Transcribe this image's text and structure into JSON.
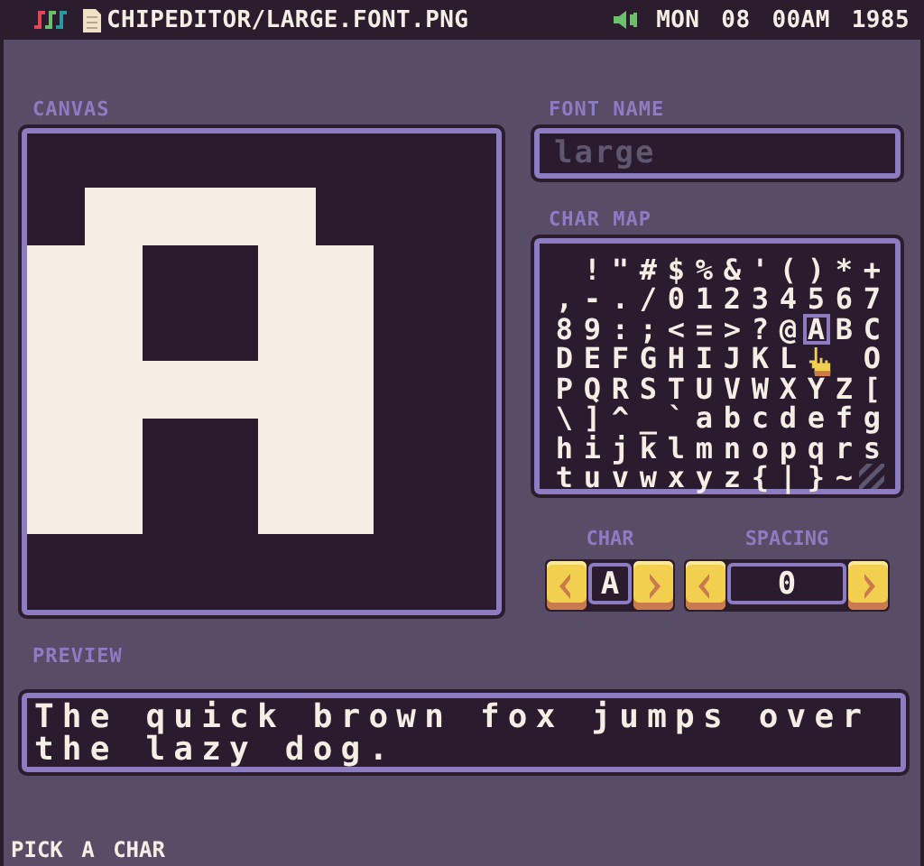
{
  "top_bar": {
    "path": "CHIPEDITOR/LARGE.FONT.PNG",
    "clock": "MON 08 00AM 1985"
  },
  "canvas": {
    "label": "CANVAS"
  },
  "font_name": {
    "label": "FONT NAME",
    "placeholder": "large"
  },
  "char_map": {
    "label": "CHAR MAP",
    "cells": [
      {
        "char": "!",
        "selected": false
      },
      {
        "char": "\"",
        "selected": false
      },
      {
        "char": "#",
        "selected": false
      },
      {
        "char": "$",
        "selected": false
      },
      {
        "char": "%",
        "selected": false
      },
      {
        "char": "&",
        "selected": false
      },
      {
        "char": "'",
        "selected": false
      },
      {
        "char": "(",
        "selected": false
      },
      {
        "char": ")",
        "selected": false
      },
      {
        "char": "*",
        "selected": false
      },
      {
        "char": "+",
        "selected": false
      },
      {
        "char": ",",
        "selected": false
      },
      {
        "char": "-",
        "selected": false
      },
      {
        "char": ".",
        "selected": false
      },
      {
        "char": "/",
        "selected": false
      },
      {
        "char": "0",
        "selected": false
      },
      {
        "char": "1",
        "selected": false
      },
      {
        "char": "2",
        "selected": false
      },
      {
        "char": "3",
        "selected": false
      },
      {
        "char": "4",
        "selected": false
      },
      {
        "char": "5",
        "selected": false
      },
      {
        "char": "6",
        "selected": false
      },
      {
        "char": "7",
        "selected": false
      },
      {
        "char": "8",
        "selected": false
      },
      {
        "char": "9",
        "selected": false
      },
      {
        "char": ":",
        "selected": false
      },
      {
        "char": ";",
        "selected": false
      },
      {
        "char": "<",
        "selected": false
      },
      {
        "char": "=",
        "selected": false
      },
      {
        "char": ">",
        "selected": false
      },
      {
        "char": "?",
        "selected": false
      },
      {
        "char": "@",
        "selected": false
      },
      {
        "char": "A",
        "selected": true
      },
      {
        "char": "B",
        "selected": false
      },
      {
        "char": "C",
        "selected": false
      },
      {
        "char": "D",
        "selected": false
      },
      {
        "char": "E",
        "selected": false
      },
      {
        "char": "F",
        "selected": false
      },
      {
        "char": "G",
        "selected": false
      },
      {
        "char": "H",
        "selected": false
      },
      {
        "char": "I",
        "selected": false
      },
      {
        "char": "J",
        "selected": false
      },
      {
        "char": "K",
        "selected": false
      },
      {
        "char": "L",
        "selected": false
      },
      {
        "kind": "cursor"
      },
      {
        "char": "O",
        "selected": false
      },
      {
        "char": "P",
        "selected": false
      },
      {
        "char": "Q",
        "selected": false
      },
      {
        "char": "R",
        "selected": false
      },
      {
        "char": "S",
        "selected": false
      },
      {
        "char": "T",
        "selected": false
      },
      {
        "char": "U",
        "selected": false
      },
      {
        "char": "V",
        "selected": false
      },
      {
        "char": "W",
        "selected": false
      },
      {
        "char": "X",
        "selected": false
      },
      {
        "char": "Y",
        "selected": false
      },
      {
        "char": "Z",
        "selected": false
      },
      {
        "char": "[",
        "selected": false
      },
      {
        "char": "\\",
        "selected": false
      },
      {
        "char": "]",
        "selected": false
      },
      {
        "char": "^",
        "selected": false
      },
      {
        "char": "_",
        "selected": false
      },
      {
        "char": "`",
        "selected": false
      },
      {
        "char": "a",
        "selected": false
      },
      {
        "char": "b",
        "selected": false
      },
      {
        "char": "c",
        "selected": false
      },
      {
        "char": "d",
        "selected": false
      },
      {
        "char": "e",
        "selected": false
      },
      {
        "char": "f",
        "selected": false
      },
      {
        "char": "g",
        "selected": false
      },
      {
        "char": "h",
        "selected": false
      },
      {
        "char": "i",
        "selected": false
      },
      {
        "char": "j",
        "selected": false
      },
      {
        "char": "k",
        "selected": false
      },
      {
        "char": "l",
        "selected": false
      },
      {
        "char": "m",
        "selected": false
      },
      {
        "char": "n",
        "selected": false
      },
      {
        "char": "o",
        "selected": false
      },
      {
        "char": "p",
        "selected": false
      },
      {
        "char": "q",
        "selected": false
      },
      {
        "char": "r",
        "selected": false
      },
      {
        "char": "s",
        "selected": false
      },
      {
        "char": "t",
        "selected": false
      },
      {
        "char": "u",
        "selected": false
      },
      {
        "char": "v",
        "selected": false
      },
      {
        "char": "w",
        "selected": false
      },
      {
        "char": "x",
        "selected": false
      },
      {
        "char": "y",
        "selected": false
      },
      {
        "char": "z",
        "selected": false
      },
      {
        "char": "{",
        "selected": false
      },
      {
        "char": "|",
        "selected": false
      },
      {
        "char": "}",
        "selected": false
      },
      {
        "char": "~",
        "selected": false
      }
    ]
  },
  "char_stepper": {
    "label": "CHAR",
    "value": "A"
  },
  "spacing_stepper": {
    "label": "SPACING",
    "value": "0"
  },
  "preview": {
    "label": "PREVIEW",
    "text": "The quick brown fox jumps over the lazy dog."
  },
  "status": "PICK A CHAR"
}
